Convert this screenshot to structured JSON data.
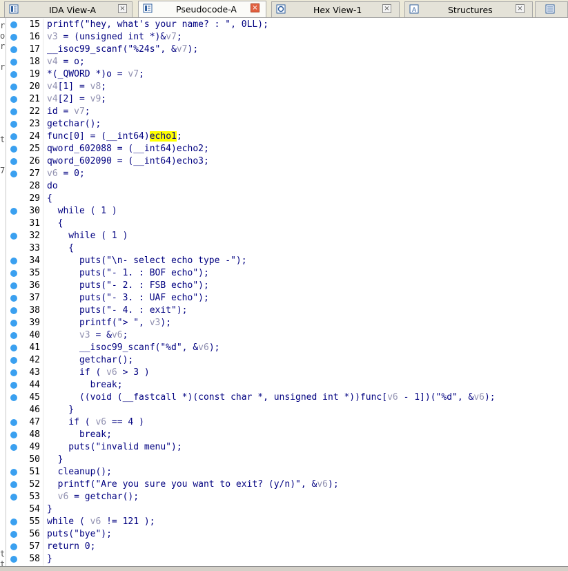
{
  "tabs": [
    {
      "label": "IDA View-A",
      "icon": "ida-view-icon",
      "active": false
    },
    {
      "label": "Pseudocode-A",
      "icon": "pseudocode-icon",
      "active": true
    },
    {
      "label": "Hex View-1",
      "icon": "hex-view-icon",
      "active": false
    },
    {
      "label": "Structures",
      "icon": "structures-icon",
      "active": false
    }
  ],
  "close_glyph": "×",
  "left_margin_marks": [
    "r",
    "o",
    "r",
    "",
    "r",
    "",
    "",
    "",
    "",
    "",
    "",
    "t",
    "",
    "",
    "7",
    "",
    "",
    "",
    "",
    "",
    "",
    "",
    "",
    "",
    "",
    "",
    "",
    "",
    "",
    "",
    "",
    "",
    "",
    "",
    "",
    "",
    "",
    "",
    "",
    "",
    "",
    "",
    "",
    "",
    "",
    "",
    "",
    "",
    "",
    "",
    "",
    "t",
    "t"
  ],
  "code_lines": [
    {
      "n": "15",
      "text": "printf(\"hey, what's your name? : \", 0LL);"
    },
    {
      "n": "16",
      "text": "v3 = (unsigned int *)&v7;"
    },
    {
      "n": "17",
      "text": "__isoc99_scanf(\"%24s\", &v7);"
    },
    {
      "n": "18",
      "text": "v4 = o;"
    },
    {
      "n": "19",
      "text": "*(_QWORD *)o = v7;"
    },
    {
      "n": "20",
      "text": "v4[1] = v8;"
    },
    {
      "n": "21",
      "text": "v4[2] = v9;"
    },
    {
      "n": "22",
      "text": "id = v7;"
    },
    {
      "n": "23",
      "text": "getchar();"
    },
    {
      "n": "24",
      "text": "func[0] = (__int64)echo1;"
    },
    {
      "n": "25",
      "text": "qword_602088 = (__int64)echo2;"
    },
    {
      "n": "26",
      "text": "qword_602090 = (__int64)echo3;"
    },
    {
      "n": "27",
      "text": "v6 = 0;"
    },
    {
      "n": "28",
      "text": "do"
    },
    {
      "n": "29",
      "text": "{"
    },
    {
      "n": "30",
      "text": "  while ( 1 )"
    },
    {
      "n": "31",
      "text": "  {"
    },
    {
      "n": "32",
      "text": "    while ( 1 )"
    },
    {
      "n": "33",
      "text": "    {"
    },
    {
      "n": "34",
      "text": "      puts(\"\\n- select echo type -\");"
    },
    {
      "n": "35",
      "text": "      puts(\"- 1. : BOF echo\");"
    },
    {
      "n": "36",
      "text": "      puts(\"- 2. : FSB echo\");"
    },
    {
      "n": "37",
      "text": "      puts(\"- 3. : UAF echo\");"
    },
    {
      "n": "38",
      "text": "      puts(\"- 4. : exit\");"
    },
    {
      "n": "39",
      "text": "      printf(\"> \", v3);"
    },
    {
      "n": "40",
      "text": "      v3 = &v6;"
    },
    {
      "n": "41",
      "text": "      __isoc99_scanf(\"%d\", &v6);"
    },
    {
      "n": "42",
      "text": "      getchar();"
    },
    {
      "n": "43",
      "text": "      if ( v6 > 3 )"
    },
    {
      "n": "44",
      "text": "        break;"
    },
    {
      "n": "45",
      "text": "      ((void (__fastcall *)(const char *, unsigned int *))func[v6 - 1])(\"%d\", &v6);"
    },
    {
      "n": "46",
      "text": "    }"
    },
    {
      "n": "47",
      "text": "    if ( v6 == 4 )"
    },
    {
      "n": "48",
      "text": "      break;"
    },
    {
      "n": "49",
      "text": "    puts(\"invalid menu\");"
    },
    {
      "n": "50",
      "text": "  }"
    },
    {
      "n": "51",
      "text": "  cleanup();"
    },
    {
      "n": "52",
      "text": "  printf(\"Are you sure you want to exit? (y/n)\", &v6);"
    },
    {
      "n": "53",
      "text": "  v6 = getchar();"
    },
    {
      "n": "54",
      "text": "}"
    },
    {
      "n": "55",
      "text": "while ( v6 != 121 );"
    },
    {
      "n": "56",
      "text": "puts(\"bye\");"
    },
    {
      "n": "57",
      "text": "return 0;"
    },
    {
      "n": "58",
      "text": "}"
    }
  ],
  "breakpoint_lines": [
    "15",
    "16",
    "17",
    "18",
    "19",
    "20",
    "21",
    "22",
    "23",
    "24",
    "25",
    "26",
    "27",
    "30",
    "32",
    "34",
    "35",
    "36",
    "37",
    "38",
    "39",
    "40",
    "41",
    "42",
    "43",
    "44",
    "45",
    "47",
    "48",
    "49",
    "51",
    "52",
    "53",
    "55",
    "56",
    "57",
    "58"
  ],
  "highlighted_token": "echo1",
  "colors": {
    "breakpoint_dot": "#3aa0f0",
    "highlight": "#ffff00",
    "code_text": "#000080",
    "variable_text": "#9090b0"
  }
}
